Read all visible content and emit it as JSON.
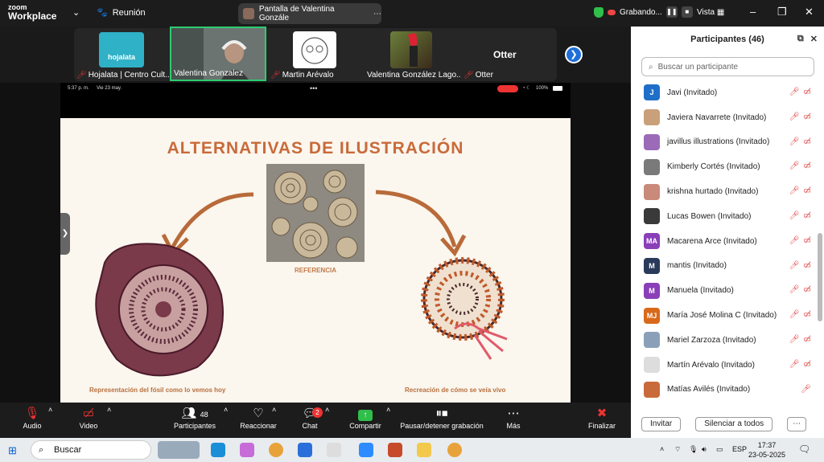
{
  "app": {
    "logo_top": "zoom",
    "logo_bottom": "Workplace",
    "meeting_label": "Reunión"
  },
  "share_banner": "Pantalla de Valentina Gonzále",
  "recording": {
    "label": "Grabando..."
  },
  "view_label": "Vista",
  "video_strip": [
    {
      "name": "Hojalata | Centro Cult...",
      "logo": "hojalata"
    },
    {
      "name": "Valentina Gonzalez"
    },
    {
      "name": "Martin Arévalo"
    },
    {
      "name": "Valentina González Lago..."
    },
    {
      "name": "Otter",
      "big": "Otter"
    }
  ],
  "ipad": {
    "time": "5:37 p. m.",
    "date": "Vie 23 may.",
    "battery": "100%"
  },
  "slide": {
    "title": "ALTERNATIVAS DE ILUSTRACIÓN",
    "ref_label": "REFERENCIA",
    "left_caption": "Representación del fósil como lo vemos hoy",
    "right_caption": "Recreación de cómo se veía vivo"
  },
  "panel": {
    "title": "Participantes (46)",
    "search_placeholder": "Buscar un participante",
    "participants": [
      {
        "name": "Javi (Invitado)",
        "initials": "J",
        "color": "#1f6fc9"
      },
      {
        "name": "Javiera Navarrete (Invitado)",
        "initials": "",
        "color": "#c9a07a"
      },
      {
        "name": "javillus illustrations (Invitado)",
        "initials": "",
        "color": "#9b6bb8"
      },
      {
        "name": "Kimberly Cortés (Invitado)",
        "initials": "",
        "color": "#7a7a7a"
      },
      {
        "name": "krishna hurtado (Invitado)",
        "initials": "",
        "color": "#c98a7a"
      },
      {
        "name": "Lucas Bowen (Invitado)",
        "initials": "",
        "color": "#3a3a3a"
      },
      {
        "name": "Macarena Arce (Invitado)",
        "initials": "MA",
        "color": "#8a3fb8"
      },
      {
        "name": "mantis (Invitado)",
        "initials": "M",
        "color": "#2a3a5a"
      },
      {
        "name": "Manuela (Invitado)",
        "initials": "M",
        "color": "#8a3fb8"
      },
      {
        "name": "María José Molina C (Invitado)",
        "initials": "MJ",
        "color": "#d9691a"
      },
      {
        "name": "Mariel Zarzoza (Invitado)",
        "initials": "",
        "color": "#8aa0b8"
      },
      {
        "name": "Martín Arévalo (Invitado)",
        "initials": "",
        "color": "#dddddd"
      },
      {
        "name": "Matías Avilés (Invitado)",
        "initials": "",
        "color": "#c96a3a"
      }
    ],
    "invite_label": "Invitar",
    "mute_all_label": "Silenciar a todos"
  },
  "toolbar": {
    "audio": "Audio",
    "video": "Video",
    "participants": "Participantes",
    "participants_count": "48",
    "react": "Reaccionar",
    "chat": "Chat",
    "chat_badge": "2",
    "share": "Compartir",
    "recording": "Pausar/detener grabación",
    "more": "Más",
    "end": "Finalizar"
  },
  "taskbar": {
    "search": "Buscar",
    "lang": "ESP",
    "time": "17:37",
    "date": "23-05-2025"
  }
}
